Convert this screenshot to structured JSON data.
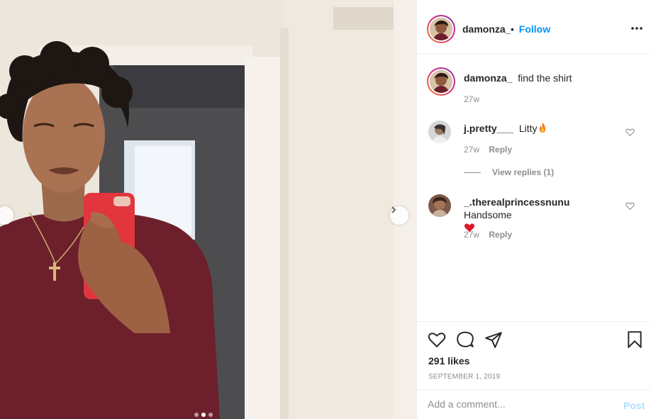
{
  "post": {
    "author": "damonza_",
    "follow_separator": "•",
    "follow_label": "Follow",
    "caption_user": "damonza_",
    "caption_text": "find the shirt",
    "caption_age": "27w",
    "likes": "291 likes",
    "date": "SEPTEMBER 1, 2019",
    "image_count": 3,
    "active_image_index": 1
  },
  "comments": [
    {
      "user": "j.pretty___",
      "text": "Litty",
      "emoji": "fire-icon",
      "age": "27w",
      "reply_label": "Reply",
      "view_replies_label": "View replies (1)"
    },
    {
      "user": "_.therealprincessnunu",
      "text": "Handsome",
      "emoji": "red-heart-icon",
      "age": "27w",
      "reply_label": "Reply"
    }
  ],
  "comment_box": {
    "placeholder": "Add a comment...",
    "post_label": "Post"
  },
  "colors": {
    "link": "#0095f6",
    "muted": "#8e8e8e",
    "post_disabled": "#b2dffc"
  }
}
